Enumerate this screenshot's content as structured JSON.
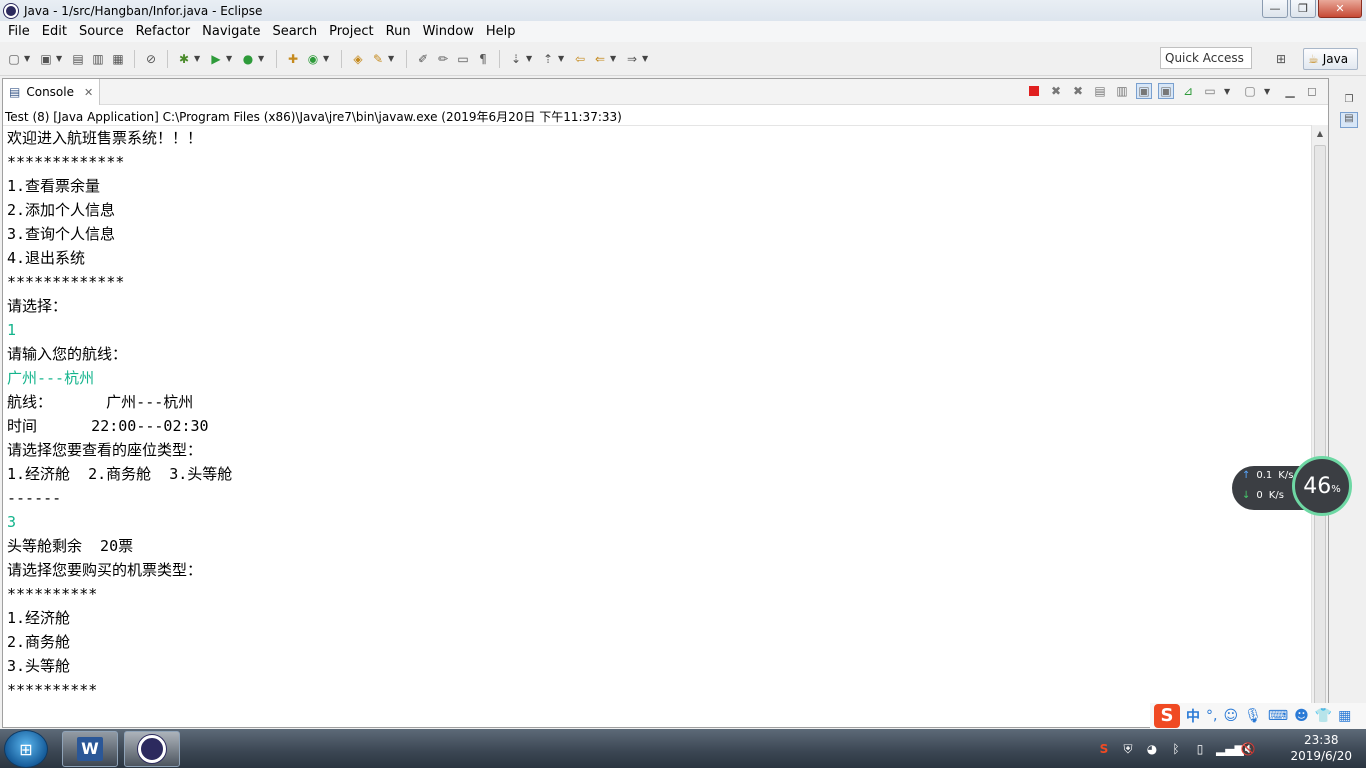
{
  "window": {
    "title": "Java - 1/src/Hangban/Infor.java - Eclipse",
    "minimize": "—",
    "maximize": "❐",
    "close": "✕"
  },
  "menu": [
    "File",
    "Edit",
    "Source",
    "Refactor",
    "Navigate",
    "Search",
    "Project",
    "Run",
    "Window",
    "Help"
  ],
  "toolbar": {
    "quick_access": "Quick Access",
    "perspective_label": "Java"
  },
  "console": {
    "tab_label": "Console",
    "process": "Test (8) [Java Application] C:\\Program Files (x86)\\Java\\jre7\\bin\\javaw.exe (2019年6月20日 下午11:37:33)",
    "lines": [
      {
        "text": "欢迎进入航班售票系统！！！",
        "type": "output"
      },
      {
        "text": "*************",
        "type": "output"
      },
      {
        "text": "1.查看票余量",
        "type": "output"
      },
      {
        "text": "2.添加个人信息",
        "type": "output"
      },
      {
        "text": "3.查询个人信息",
        "type": "output"
      },
      {
        "text": "4.退出系统",
        "type": "output"
      },
      {
        "text": "*************",
        "type": "output"
      },
      {
        "text": "请选择：",
        "type": "output"
      },
      {
        "text": "1",
        "type": "input"
      },
      {
        "text": "请输入您的航线：",
        "type": "output"
      },
      {
        "text": "广州---杭州",
        "type": "input"
      },
      {
        "text": "航线：      广州---杭州",
        "type": "output"
      },
      {
        "text": "时间      22:00---02:30",
        "type": "output"
      },
      {
        "text": "请选择您要查看的座位类型：",
        "type": "output"
      },
      {
        "text": "1.经济舱  2.商务舱  3.头等舱",
        "type": "output"
      },
      {
        "text": "------",
        "type": "output"
      },
      {
        "text": "3",
        "type": "input"
      },
      {
        "text": "头等舱剩余  20票",
        "type": "output"
      },
      {
        "text": "请选择您要购买的机票类型：",
        "type": "output"
      },
      {
        "text": "**********",
        "type": "output"
      },
      {
        "text": "1.经济舱",
        "type": "output"
      },
      {
        "text": "2.商务舱",
        "type": "output"
      },
      {
        "text": "3.头等舱",
        "type": "output"
      },
      {
        "text": "**********",
        "type": "output"
      }
    ]
  },
  "network": {
    "upload": "0.1",
    "upload_unit": "K/s",
    "download": "0",
    "download_unit": "K/s",
    "percent": "46",
    "percent_unit": "%"
  },
  "ime": {
    "logo": "S",
    "mode": "中",
    "punct": "°,"
  },
  "clock": {
    "time": "23:38",
    "date": "2019/6/20"
  },
  "taskbar": {
    "word_label": "W"
  },
  "colors": {
    "input_text": "#14b48c",
    "stop_red": "#e02020",
    "taskbar": "#3a4552"
  }
}
